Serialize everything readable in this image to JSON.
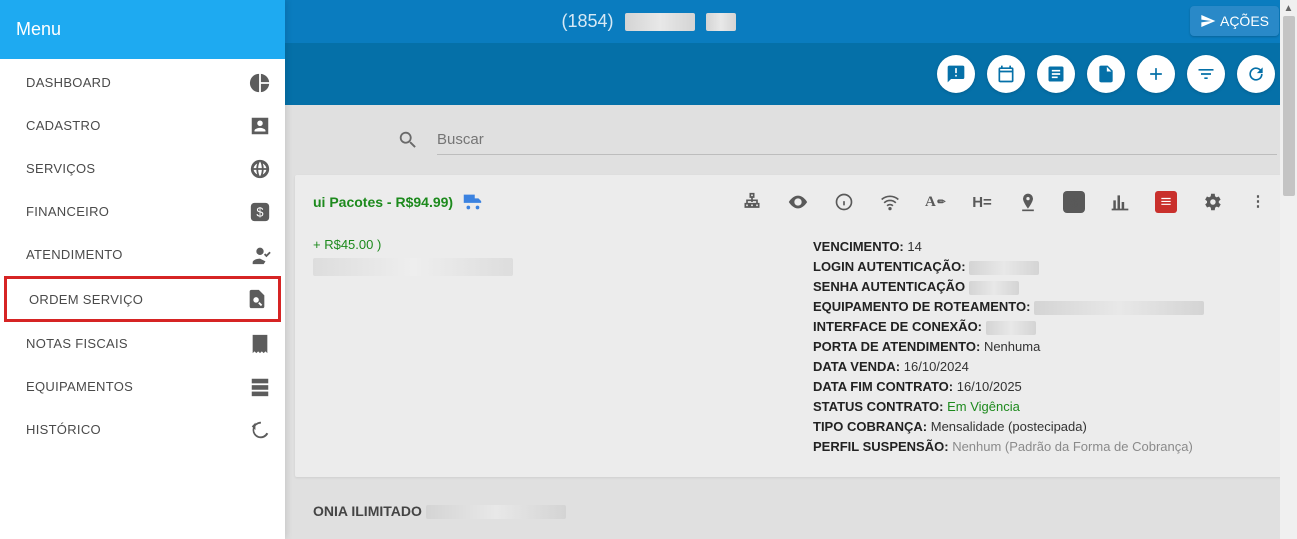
{
  "header": {
    "title_prefix": "(1854)",
    "acoes_label": "AÇÕES"
  },
  "sidebar": {
    "title": "Menu",
    "items": [
      {
        "label": "DASHBOARD",
        "icon": "pie-chart-icon",
        "highlight": false
      },
      {
        "label": "CADASTRO",
        "icon": "person-icon",
        "highlight": false
      },
      {
        "label": "SERVIÇOS",
        "icon": "globe-icon",
        "highlight": false
      },
      {
        "label": "FINANCEIRO",
        "icon": "dollar-icon",
        "highlight": false
      },
      {
        "label": "ATENDIMENTO",
        "icon": "agent-icon",
        "highlight": false
      },
      {
        "label": "ORDEM SERVIÇO",
        "icon": "order-search-icon",
        "highlight": true
      },
      {
        "label": "NOTAS FISCAIS",
        "icon": "receipt-icon",
        "highlight": false
      },
      {
        "label": "EQUIPAMENTOS",
        "icon": "server-icon",
        "highlight": false
      },
      {
        "label": "HISTÓRICO",
        "icon": "history-icon",
        "highlight": false
      }
    ]
  },
  "search": {
    "placeholder": "Buscar"
  },
  "plan_card": {
    "head_text": "ui Pacotes - R$94.99)",
    "addon_text": "+ R$45.00 )",
    "details": {
      "vencimento_label": "VENCIMENTO:",
      "vencimento_value": "14",
      "login_label": "LOGIN AUTENTICAÇÃO:",
      "senha_label": "SENHA AUTENTICAÇÃO",
      "equip_label": "EQUIPAMENTO DE ROTEAMENTO:",
      "iface_label": "INTERFACE DE CONEXÃO:",
      "porta_label": "PORTA DE ATENDIMENTO:",
      "porta_value": "Nenhuma",
      "venda_label": "DATA VENDA:",
      "venda_value": "16/10/2024",
      "fim_label": "DATA FIM CONTRATO:",
      "fim_value": "16/10/2025",
      "status_label": "STATUS CONTRATO:",
      "status_value": "Em Vigência",
      "cobranca_label": "TIPO COBRANÇA:",
      "cobranca_value": "Mensalidade (postecipada)",
      "perfil_label": "PERFIL SUSPENSÃO:",
      "perfil_value": "Nenhum (Padrão da Forma de Cobrança)"
    }
  },
  "plan_card2": {
    "prefix": "ONIA ILIMITADO"
  }
}
